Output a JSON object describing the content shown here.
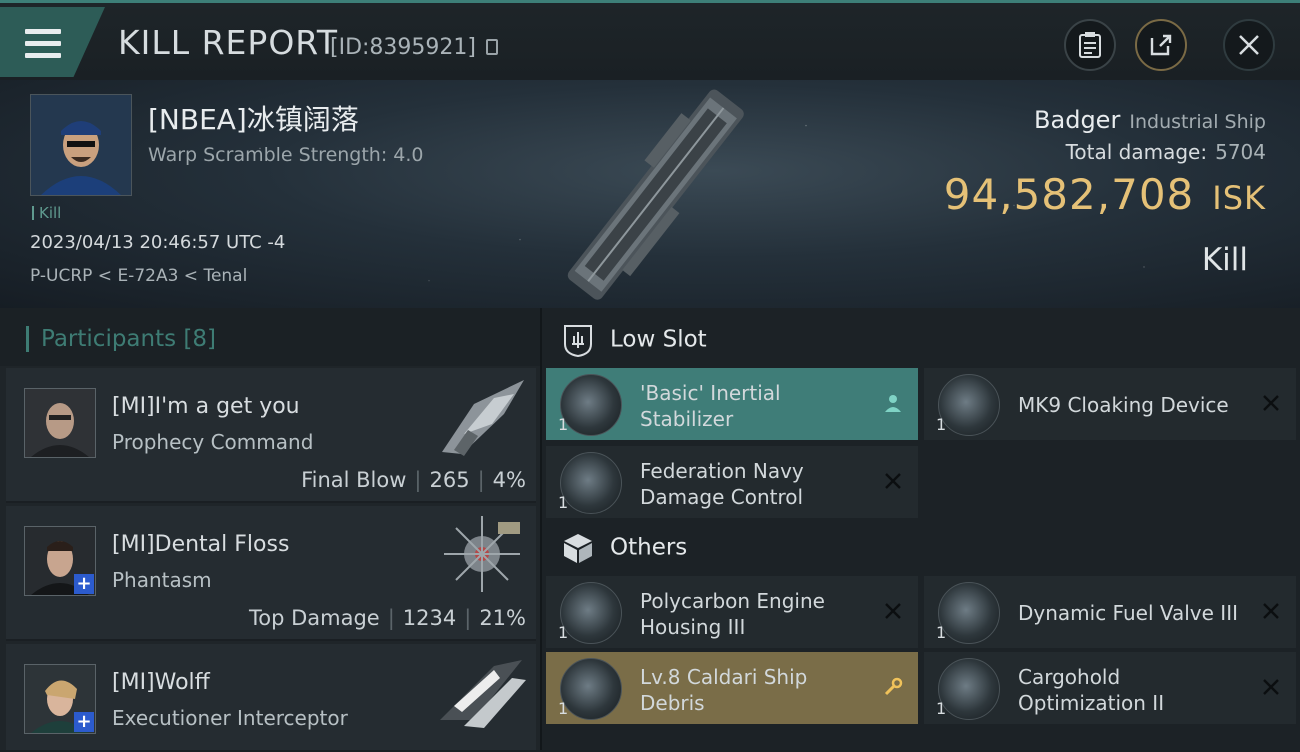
{
  "header": {
    "title": "KILL REPORT",
    "kill_id": "[ID:8395921]"
  },
  "victim": {
    "name": "[NBEA]冰镇阔落",
    "warp_scramble": "Warp Scramble Strength: 4.0",
    "status": "Kill",
    "timestamp": "2023/04/13 20:46:57 UTC -4",
    "location": "P-UCRP < E-72A3 < Tenal",
    "ship_name": "Badger",
    "ship_class": "Industrial Ship",
    "total_damage_label": "Total damage:",
    "total_damage": "5704",
    "isk_value": "94,582,708",
    "isk_unit": "ISK",
    "result": "Kill"
  },
  "participants": {
    "title": "Participants",
    "count": "[8]",
    "items": [
      {
        "name": "[MI]I'm a get you",
        "ship": "Prophecy Command",
        "tag": "Final Blow",
        "damage": "265",
        "percent": "4%"
      },
      {
        "name": "[MI]Dental Floss",
        "ship": "Phantasm",
        "tag": "Top Damage",
        "damage": "1234",
        "percent": "21%"
      },
      {
        "name": "[MI]Wolff",
        "ship": "Executioner Interceptor",
        "tag": "",
        "damage": "",
        "percent": ""
      }
    ]
  },
  "slots": {
    "low_slot_title": "Low Slot",
    "others_title": "Others",
    "low": [
      {
        "name": "'Basic' Inertial Stabilizer",
        "qty": "1",
        "state": "dropped"
      },
      {
        "name": "MK9 Cloaking Device",
        "qty": "1",
        "state": "destroyed"
      },
      {
        "name": "Federation Navy Damage Control",
        "qty": "1",
        "state": "destroyed"
      }
    ],
    "others": [
      {
        "name": "Polycarbon Engine Housing III",
        "qty": "1",
        "state": "destroyed"
      },
      {
        "name": "Dynamic Fuel Valve III",
        "qty": "1",
        "state": "destroyed"
      },
      {
        "name": "Lv.8 Caldari Ship Debris",
        "qty": "1",
        "state": "salvage"
      },
      {
        "name": "Cargohold Optimization II",
        "qty": "1",
        "state": "destroyed"
      }
    ]
  },
  "colors": {
    "accent_teal": "#3f7d78",
    "isk_gold": "#e5c177",
    "salvage_gold": "#7a6d48"
  }
}
